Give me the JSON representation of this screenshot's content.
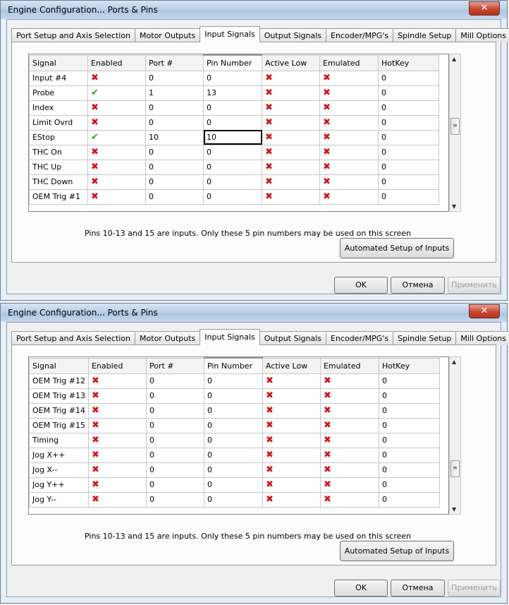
{
  "window_title": "Engine Configuration... Ports & Pins",
  "close_label": "✕",
  "tabs": [
    "Port Setup and Axis Selection",
    "Motor Outputs",
    "Input Signals",
    "Output Signals",
    "Encoder/MPG's",
    "Spindle Setup",
    "Mill Options"
  ],
  "active_tab": "Input Signals",
  "columns": [
    "Signal",
    "Enabled",
    "Port #",
    "Pin Number",
    "Active Low",
    "Emulated",
    "HotKey"
  ],
  "note": "Pins 10-13 and 15 are inputs. Only these 5 pin numbers may be used on this screen",
  "buttons": {
    "automated": "Automated Setup of Inputs",
    "ok": "OK",
    "cancel": "Отмена",
    "apply": "Применить"
  },
  "icons": {
    "x": "red-x-icon",
    "check": "green-check-icon"
  },
  "colors": {
    "x": "#d4121a",
    "check": "#22aa22"
  },
  "dialogs": [
    {
      "rows": [
        {
          "signal": "Input #4",
          "enabled": false,
          "port": "0",
          "pin": "0",
          "active_low": false,
          "emulated": false,
          "hotkey": "0"
        },
        {
          "signal": "Probe",
          "enabled": true,
          "port": "1",
          "pin": "13",
          "active_low": false,
          "emulated": false,
          "hotkey": "0"
        },
        {
          "signal": "Index",
          "enabled": false,
          "port": "0",
          "pin": "0",
          "active_low": false,
          "emulated": false,
          "hotkey": "0"
        },
        {
          "signal": "Limit Ovrd",
          "enabled": false,
          "port": "0",
          "pin": "0",
          "active_low": false,
          "emulated": false,
          "hotkey": "0"
        },
        {
          "signal": "EStop",
          "enabled": true,
          "port": "10",
          "pin": "10",
          "active_low": false,
          "emulated": false,
          "hotkey": "0",
          "selected": true
        },
        {
          "signal": "THC On",
          "enabled": false,
          "port": "0",
          "pin": "0",
          "active_low": false,
          "emulated": false,
          "hotkey": "0"
        },
        {
          "signal": "THC Up",
          "enabled": false,
          "port": "0",
          "pin": "0",
          "active_low": false,
          "emulated": false,
          "hotkey": "0"
        },
        {
          "signal": "THC Down",
          "enabled": false,
          "port": "0",
          "pin": "0",
          "active_low": false,
          "emulated": false,
          "hotkey": "0"
        },
        {
          "signal": "OEM Trig #1",
          "enabled": false,
          "port": "0",
          "pin": "0",
          "active_low": false,
          "emulated": false,
          "hotkey": "0"
        }
      ]
    },
    {
      "rows": [
        {
          "signal": "OEM Trig #12",
          "enabled": false,
          "port": "0",
          "pin": "0",
          "active_low": false,
          "emulated": false,
          "hotkey": "0"
        },
        {
          "signal": "OEM Trig #13",
          "enabled": false,
          "port": "0",
          "pin": "0",
          "active_low": false,
          "emulated": false,
          "hotkey": "0"
        },
        {
          "signal": "OEM Trig #14",
          "enabled": false,
          "port": "0",
          "pin": "0",
          "active_low": false,
          "emulated": false,
          "hotkey": "0"
        },
        {
          "signal": "OEM Trig #15",
          "enabled": false,
          "port": "0",
          "pin": "0",
          "active_low": false,
          "emulated": false,
          "hotkey": "0"
        },
        {
          "signal": "Timing",
          "enabled": false,
          "port": "0",
          "pin": "0",
          "active_low": false,
          "emulated": false,
          "hotkey": "0"
        },
        {
          "signal": "Jog X++",
          "enabled": false,
          "port": "0",
          "pin": "0",
          "active_low": false,
          "emulated": false,
          "hotkey": "0"
        },
        {
          "signal": "Jog X--",
          "enabled": false,
          "port": "0",
          "pin": "0",
          "active_low": false,
          "emulated": false,
          "hotkey": "0"
        },
        {
          "signal": "Jog Y++",
          "enabled": false,
          "port": "0",
          "pin": "0",
          "active_low": false,
          "emulated": false,
          "hotkey": "0"
        },
        {
          "signal": "Jog Y--",
          "enabled": false,
          "port": "0",
          "pin": "0",
          "active_low": false,
          "emulated": false,
          "hotkey": "0"
        }
      ]
    }
  ]
}
